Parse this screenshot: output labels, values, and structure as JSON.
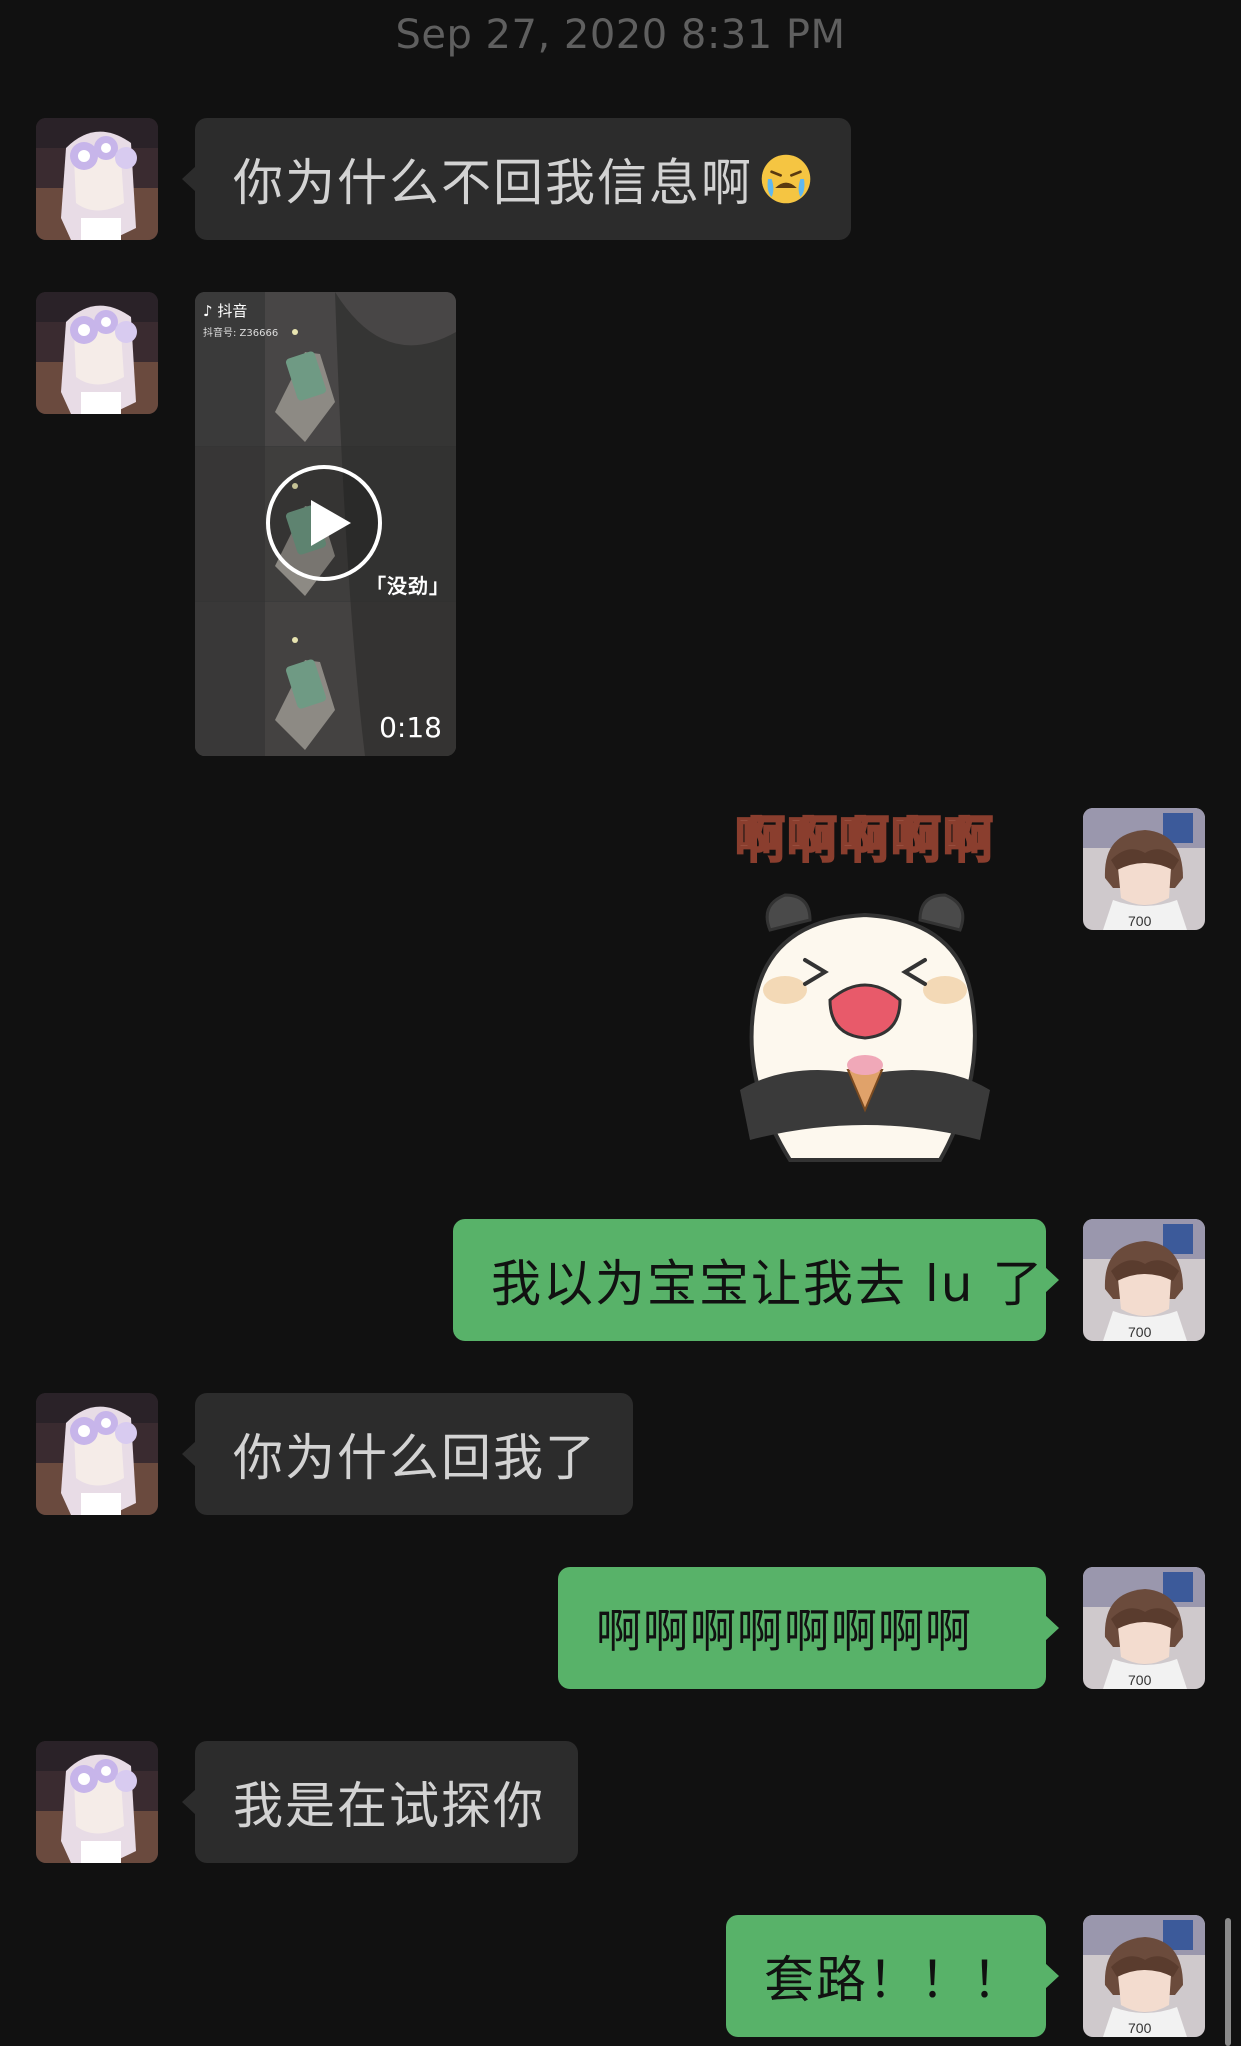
{
  "chat": {
    "timestamp": "Sep 27, 2020 8:31 PM",
    "messages": [
      {
        "from": "other",
        "type": "text",
        "text": "你为什么不回我信息啊",
        "emoji": "crying-face-emoji"
      },
      {
        "from": "other",
        "type": "video",
        "app_label": "抖音",
        "app_id": "抖音号: Z36666",
        "caption": "「没劲」",
        "duration": "0:18"
      },
      {
        "from": "me",
        "type": "sticker",
        "text": "啊啊啊啊啊",
        "sticker": "crying-panda-sticker"
      },
      {
        "from": "me",
        "type": "text",
        "text": "我以为宝宝让我去 lu 了"
      },
      {
        "from": "other",
        "type": "text",
        "text": "你为什么回我了"
      },
      {
        "from": "me",
        "type": "text",
        "text": "啊啊啊啊啊啊啊啊"
      },
      {
        "from": "other",
        "type": "text",
        "text": "我是在试探你"
      },
      {
        "from": "me",
        "type": "text",
        "text": "套路！！！"
      }
    ]
  },
  "colors": {
    "background": "#111111",
    "incoming_bubble": "#2c2c2c",
    "outgoing_bubble": "#58b269",
    "timestamp_text": "#5f5f5f"
  }
}
